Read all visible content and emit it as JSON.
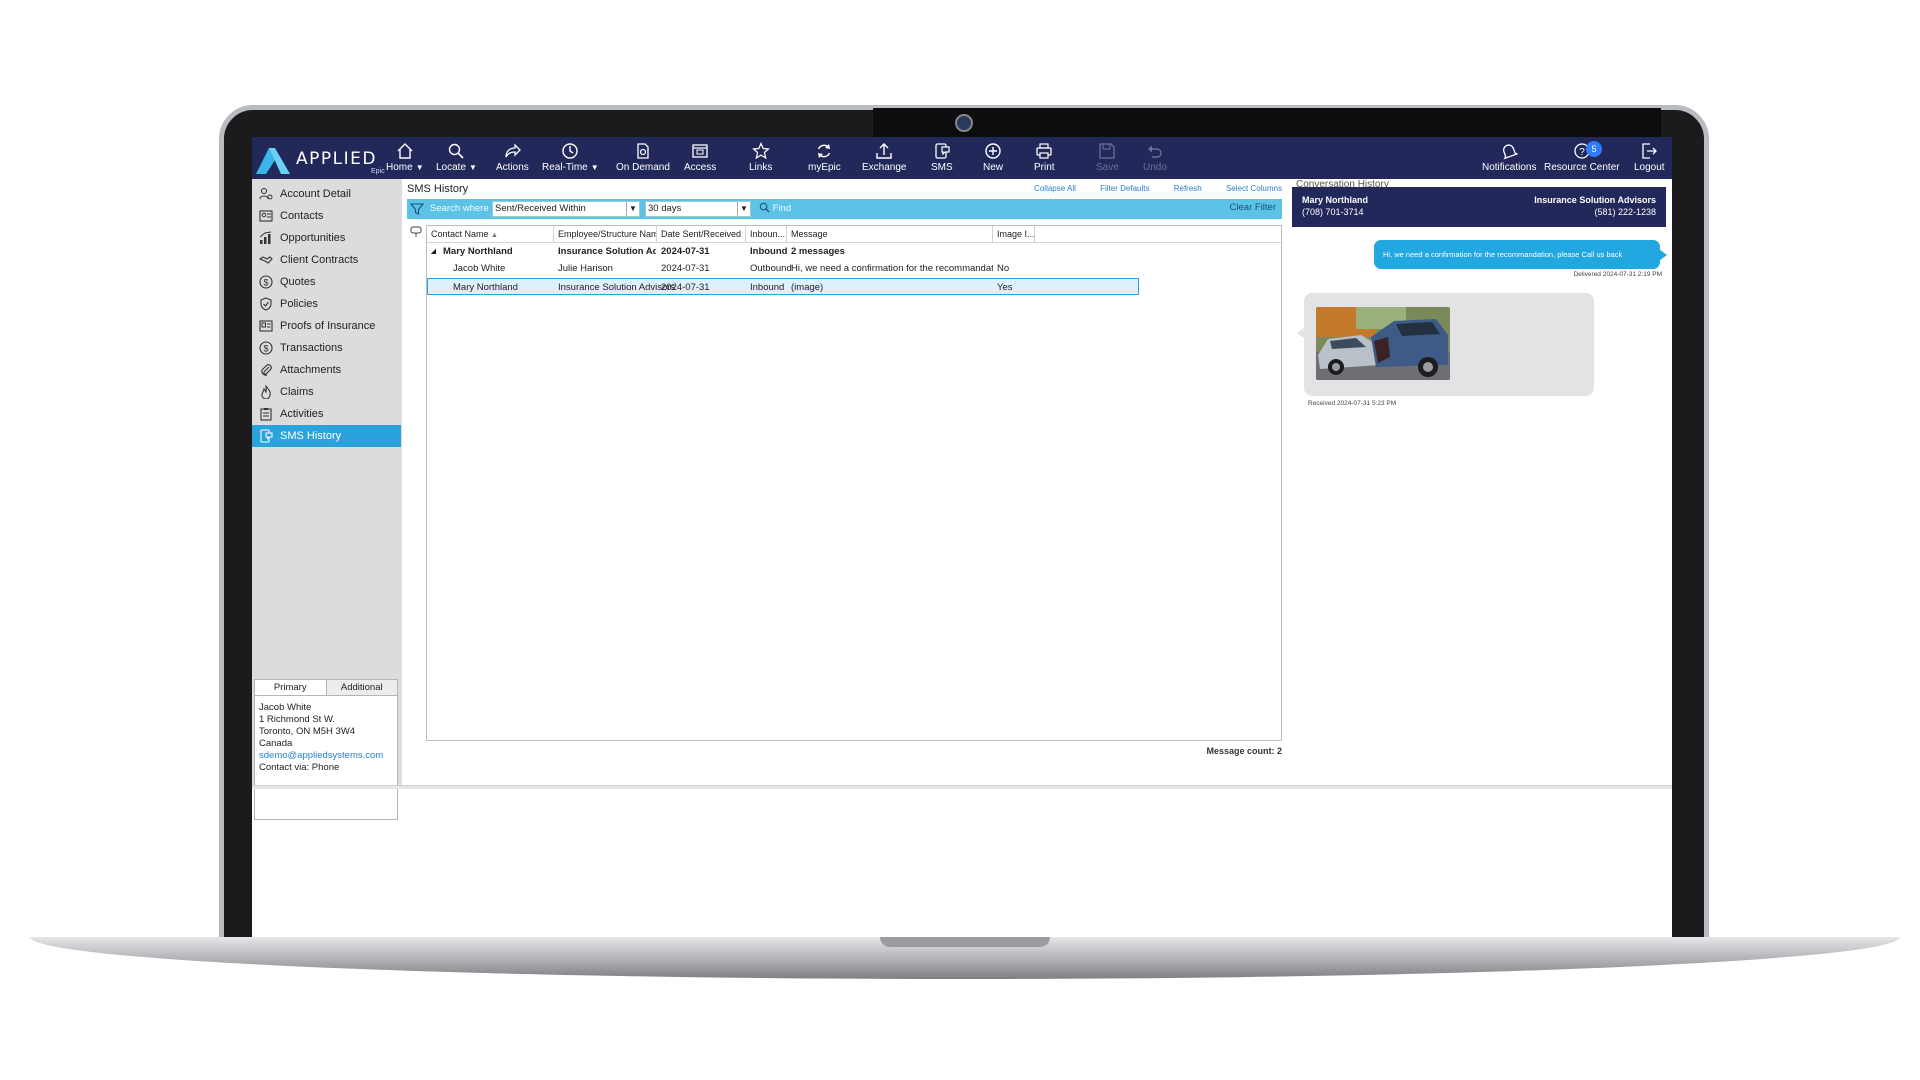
{
  "brand": {
    "name": "APPLIED",
    "sub": "Epic"
  },
  "toolbar": {
    "buttons": [
      {
        "label": "Home",
        "icon": "home-icon",
        "dropdown": true
      },
      {
        "label": "Locate",
        "icon": "search-icon",
        "dropdown": true
      },
      {
        "label": "Actions",
        "icon": "share-arrow-icon"
      },
      {
        "label": "Real-Time",
        "icon": "clock-icon",
        "dropdown": true
      },
      {
        "label": "On Demand",
        "icon": "document-icon"
      },
      {
        "label": "Access",
        "icon": "window-icon"
      },
      {
        "label": "Links",
        "icon": "star-icon"
      },
      {
        "label": "myEpic",
        "icon": "refresh-icon"
      },
      {
        "label": "Exchange",
        "icon": "upload-icon"
      },
      {
        "label": "SMS",
        "icon": "sms-icon"
      },
      {
        "label": "New",
        "icon": "plus-circle-icon"
      },
      {
        "label": "Print",
        "icon": "printer-icon"
      },
      {
        "label": "Save",
        "icon": "save-icon",
        "disabled": true
      },
      {
        "label": "Undo",
        "icon": "undo-icon",
        "disabled": true
      },
      {
        "label": "Notifications",
        "icon": "bell-icon"
      },
      {
        "label": "Resource Center",
        "icon": "help-icon",
        "badge": "5"
      },
      {
        "label": "Logout",
        "icon": "logout-icon"
      }
    ]
  },
  "nav": {
    "items": [
      {
        "label": "Account Detail",
        "icon": "account-detail-icon"
      },
      {
        "label": "Contacts",
        "icon": "contacts-icon"
      },
      {
        "label": "Opportunities",
        "icon": "opportunities-icon"
      },
      {
        "label": "Client Contracts",
        "icon": "handshake-icon"
      },
      {
        "label": "Quotes",
        "icon": "quote-icon"
      },
      {
        "label": "Policies",
        "icon": "shield-icon"
      },
      {
        "label": "Proofs of Insurance",
        "icon": "id-card-icon"
      },
      {
        "label": "Transactions",
        "icon": "dollar-icon"
      },
      {
        "label": "Attachments",
        "icon": "paperclip-icon"
      },
      {
        "label": "Claims",
        "icon": "flame-icon"
      },
      {
        "label": "Activities",
        "icon": "clipboard-icon"
      },
      {
        "label": "SMS History",
        "icon": "sms-history-icon",
        "active": true
      }
    ]
  },
  "contact_panel": {
    "tabs": [
      "Primary",
      "Additional"
    ],
    "name": "Jacob White",
    "address1": "1 Richmond St W.",
    "city": "Toronto, ON  M5H 3W4",
    "country": "Canada",
    "email": "sdemo@appliedsystems.com",
    "contact_via": "Contact via: Phone"
  },
  "main": {
    "title": "SMS History",
    "links": [
      "Collapse All",
      "Filter Defaults",
      "Refresh",
      "Select Columns"
    ],
    "filter": {
      "search_where": "Search where",
      "field": "Sent/Received Within",
      "value": "30 days",
      "find": "Find",
      "clear": "Clear Filter"
    },
    "columns": [
      "Contact Name",
      "Employee/Structure Name",
      "Date Sent/Received",
      "Inboun...",
      "Message",
      "Image I..."
    ],
    "group": {
      "name": "Mary Northland",
      "employee": "Insurance Solution Advis...",
      "date": "2024-07-31",
      "direction": "Inbound",
      "message": "2 messages"
    },
    "rows": [
      {
        "contact": "Jacob White",
        "employee": "Julie Harison",
        "date": "2024-07-31",
        "direction": "Outbound",
        "message": "Hi, we need a confirmation for the recommandation, plea...",
        "image": "No"
      },
      {
        "contact": "Mary Northland",
        "employee": "Insurance Solution Advisors",
        "date": "2024-07-31",
        "direction": "Inbound",
        "message": "(image)",
        "image": "Yes"
      }
    ],
    "message_count": "Message count: 2"
  },
  "conversation": {
    "title": "Conversation History",
    "contact_name": "Mary Northland",
    "contact_phone": "(708) 701-3714",
    "org_name": "Insurance Solution Advisors",
    "org_phone": "(581) 222-1238",
    "outgoing_text": "Hi, we need a confirmation for the recommandation, please Call us back",
    "outgoing_stamp": "Delivered 2024-07-31 2:19 PM",
    "incoming_stamp": "Received 2024-07-31 5:23 PM"
  },
  "colors": {
    "toolbar": "#23285a",
    "accent": "#2aa3dc",
    "filterbar": "#5bc3e6"
  }
}
